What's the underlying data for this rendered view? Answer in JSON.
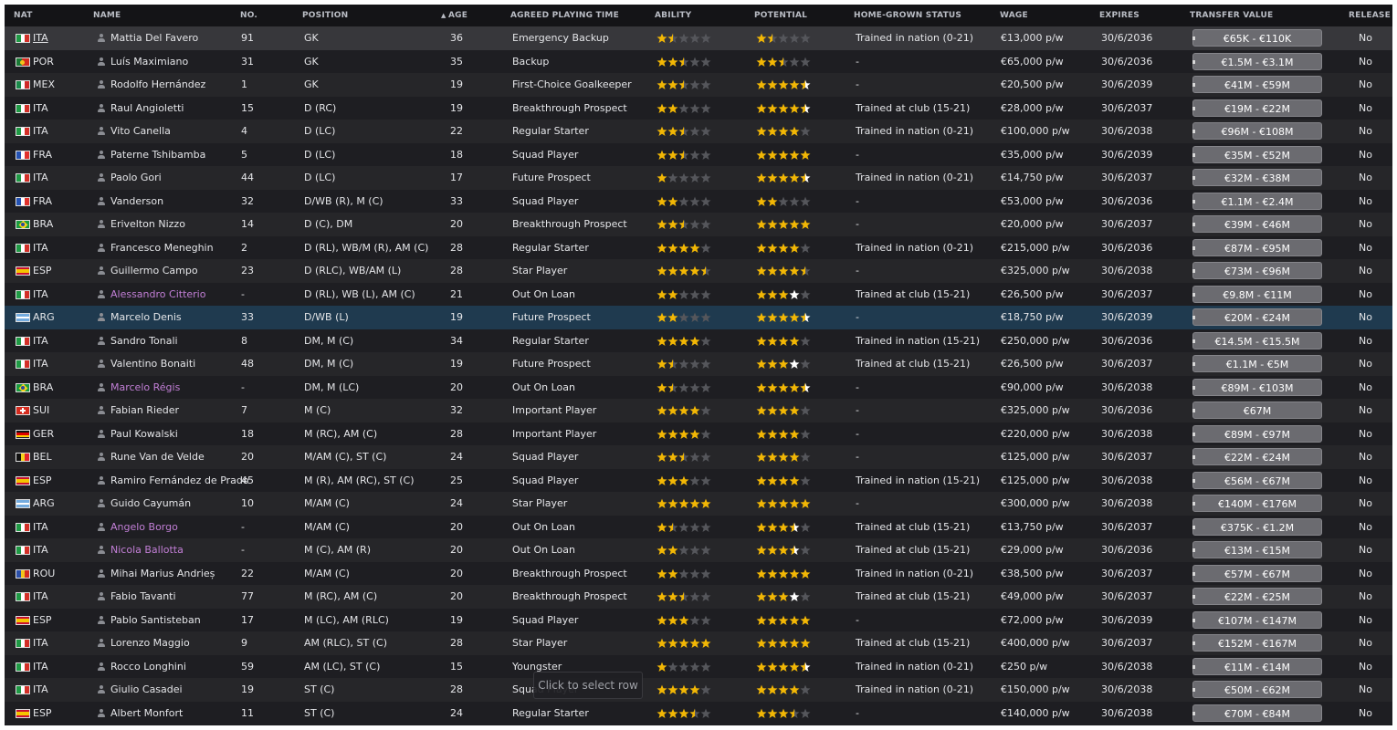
{
  "headers": {
    "nat": "NAT",
    "name": "NAME",
    "no": "NO.",
    "position": "POSITION",
    "age": "AGE",
    "playing_time": "AGREED PLAYING TIME",
    "ability": "ABILITY",
    "potential": "POTENTIAL",
    "home_grown": "HOME-GROWN STATUS",
    "wage": "WAGE",
    "expires": "EXPIRES",
    "transfer_value": "TRANSFER VALUE",
    "release": "RELEASE",
    "sort_indicator": "▲"
  },
  "tooltip": "Click to select row",
  "colors": {
    "star_gold": "#f2b705",
    "star_white": "#ffffff",
    "star_empty": "#55565b",
    "loan_name": "#c27fd6",
    "selected_row": "#1f3a4f"
  },
  "flags": {
    "ITA": [
      "#1f9a45",
      "#ffffff",
      "#d22f27"
    ],
    "FRA": [
      "#2452b3",
      "#ffffff",
      "#e0322d"
    ],
    "MEX": [
      "#1a8a4a",
      "#ffffff",
      "#cf2a27"
    ],
    "ROU": [
      "#2b4fa8",
      "#f3c51a",
      "#d52b1e"
    ],
    "BEL": [
      "#111111",
      "#f5d21c",
      "#e3232c"
    ]
  },
  "players": [
    {
      "nat": "ITA",
      "name": "Mattia Del Favero",
      "no": "91",
      "pos": "GK",
      "age": "36",
      "apt": "Emergency Backup",
      "ab": 1.5,
      "po": 1.5,
      "pw": false,
      "hg": "Trained in nation (0-21)",
      "wage": "€13,000 p/w",
      "exp": "30/6/2036",
      "tv": "€65K - €110K",
      "rel": "No"
    },
    {
      "nat": "POR",
      "name": "Luís Maximiano",
      "no": "31",
      "pos": "GK",
      "age": "35",
      "apt": "Backup",
      "ab": 2.5,
      "po": 2.5,
      "pw": false,
      "hg": "-",
      "wage": "€65,000 p/w",
      "exp": "30/6/2036",
      "tv": "€1.5M - €3.1M",
      "rel": "No"
    },
    {
      "nat": "MEX",
      "name": "Rodolfo Hernández",
      "no": "1",
      "pos": "GK",
      "age": "19",
      "apt": "First-Choice Goalkeeper",
      "ab": 2.5,
      "po": 4.5,
      "pw": true,
      "hg": "-",
      "wage": "€20,500 p/w",
      "exp": "30/6/2039",
      "tv": "€41M - €59M",
      "rel": "No"
    },
    {
      "nat": "ITA",
      "name": "Raul Angioletti",
      "no": "15",
      "pos": "D (RC)",
      "age": "19",
      "apt": "Breakthrough Prospect",
      "ab": 2,
      "po": 4.5,
      "pw": true,
      "hg": "Trained at club (15-21)",
      "wage": "€28,000 p/w",
      "exp": "30/6/2037",
      "tv": "€19M - €22M",
      "rel": "No"
    },
    {
      "nat": "ITA",
      "name": "Vito Canella",
      "no": "4",
      "pos": "D (LC)",
      "age": "22",
      "apt": "Regular Starter",
      "ab": 2.5,
      "po": 4,
      "pw": false,
      "hg": "Trained in nation (0-21)",
      "wage": "€100,000 p/w",
      "exp": "30/6/2038",
      "tv": "€96M - €108M",
      "rel": "No"
    },
    {
      "nat": "FRA",
      "name": "Paterne Tshibamba",
      "no": "5",
      "pos": "D (LC)",
      "age": "18",
      "apt": "Squad Player",
      "ab": 2.5,
      "po": 5,
      "pw": true,
      "hg": "-",
      "wage": "€35,000 p/w",
      "exp": "30/6/2039",
      "tv": "€35M - €52M",
      "rel": "No"
    },
    {
      "nat": "ITA",
      "name": "Paolo Gori",
      "no": "44",
      "pos": "D (LC)",
      "age": "17",
      "apt": "Future Prospect",
      "ab": 1,
      "po": 4.5,
      "pw": true,
      "hg": "Trained in nation (0-21)",
      "wage": "€14,750 p/w",
      "exp": "30/6/2037",
      "tv": "€32M - €38M",
      "rel": "No"
    },
    {
      "nat": "FRA",
      "name": "Vanderson",
      "no": "32",
      "pos": "D/WB (R), M (C)",
      "age": "33",
      "apt": "Squad Player",
      "ab": 2,
      "po": 2,
      "pw": false,
      "hg": "-",
      "wage": "€53,000 p/w",
      "exp": "30/6/2036",
      "tv": "€1.1M - €2.4M",
      "rel": "No"
    },
    {
      "nat": "BRA",
      "name": "Erivelton Nizzo",
      "no": "14",
      "pos": "D (C), DM",
      "age": "20",
      "apt": "Breakthrough Prospect",
      "ab": 2.5,
      "po": 5,
      "pw": true,
      "hg": "-",
      "wage": "€20,000 p/w",
      "exp": "30/6/2037",
      "tv": "€39M - €46M",
      "rel": "No"
    },
    {
      "nat": "ITA",
      "name": "Francesco Meneghin",
      "no": "2",
      "pos": "D (RL), WB/M (R), AM (C)",
      "age": "28",
      "apt": "Regular Starter",
      "ab": 4,
      "po": 4,
      "pw": false,
      "hg": "Trained in nation (0-21)",
      "wage": "€215,000 p/w",
      "exp": "30/6/2036",
      "tv": "€87M - €95M",
      "rel": "No"
    },
    {
      "nat": "ESP",
      "name": "Guillermo Campo",
      "no": "23",
      "pos": "D (RLC), WB/AM (L)",
      "age": "28",
      "apt": "Star Player",
      "ab": 4.5,
      "po": 4.5,
      "pw": false,
      "hg": "-",
      "wage": "€325,000 p/w",
      "exp": "30/6/2038",
      "tv": "€73M - €96M",
      "rel": "No"
    },
    {
      "nat": "ITA",
      "name": "Alessandro Citterio",
      "loan": true,
      "no": "-",
      "pos": "D (RL), WB (L), AM (C)",
      "age": "21",
      "apt": "Out On Loan",
      "ab": 2,
      "po": 4,
      "pw": true,
      "hg": "Trained at club (15-21)",
      "wage": "€26,500 p/w",
      "exp": "30/6/2037",
      "tv": "€9.8M - €11M",
      "rel": "No"
    },
    {
      "nat": "ARG",
      "name": "Marcelo Denis",
      "no": "33",
      "pos": "D/WB (L)",
      "age": "19",
      "apt": "Future Prospect",
      "ab": 2,
      "po": 4.5,
      "pw": true,
      "hg": "-",
      "wage": "€18,750 p/w",
      "exp": "30/6/2039",
      "tv": "€20M - €24M",
      "rel": "No"
    },
    {
      "nat": "ITA",
      "name": "Sandro Tonali",
      "no": "8",
      "pos": "DM, M (C)",
      "age": "34",
      "apt": "Regular Starter",
      "ab": 4,
      "po": 4,
      "pw": false,
      "hg": "Trained in nation (15-21)",
      "wage": "€250,000 p/w",
      "exp": "30/6/2036",
      "tv": "€14.5M - €15.5M",
      "rel": "No"
    },
    {
      "nat": "ITA",
      "name": "Valentino Bonaiti",
      "no": "48",
      "pos": "DM, M (C)",
      "age": "19",
      "apt": "Future Prospect",
      "ab": 1.5,
      "po": 4,
      "pw": true,
      "hg": "Trained at club (15-21)",
      "wage": "€26,500 p/w",
      "exp": "30/6/2037",
      "tv": "€1.1M - €5M",
      "rel": "No"
    },
    {
      "nat": "BRA",
      "name": "Marcelo Régis",
      "loan": true,
      "no": "-",
      "pos": "DM, M (LC)",
      "age": "20",
      "apt": "Out On Loan",
      "ab": 1.5,
      "po": 4.5,
      "pw": true,
      "hg": "-",
      "wage": "€90,000 p/w",
      "exp": "30/6/2038",
      "tv": "€89M - €103M",
      "rel": "No"
    },
    {
      "nat": "SUI",
      "name": "Fabian Rieder",
      "no": "7",
      "pos": "M (C)",
      "age": "32",
      "apt": "Important Player",
      "ab": 4,
      "po": 4,
      "pw": false,
      "hg": "-",
      "wage": "€325,000 p/w",
      "exp": "30/6/2036",
      "tv": "€67M",
      "rel": "No"
    },
    {
      "nat": "GER",
      "name": "Paul Kowalski",
      "no": "18",
      "pos": "M (RC), AM (C)",
      "age": "28",
      "apt": "Important Player",
      "ab": 4,
      "po": 4,
      "pw": false,
      "hg": "-",
      "wage": "€220,000 p/w",
      "exp": "30/6/2038",
      "tv": "€89M - €97M",
      "rel": "No"
    },
    {
      "nat": "BEL",
      "name": "Rune Van de Velde",
      "no": "20",
      "pos": "M/AM (C), ST (C)",
      "age": "24",
      "apt": "Squad Player",
      "ab": 2.5,
      "po": 4,
      "pw": false,
      "hg": "-",
      "wage": "€125,000 p/w",
      "exp": "30/6/2037",
      "tv": "€22M - €24M",
      "rel": "No"
    },
    {
      "nat": "ESP",
      "name": "Ramiro Fernández de Prado",
      "no": "45",
      "pos": "M (R), AM (RC), ST (C)",
      "age": "25",
      "apt": "Squad Player",
      "ab": 3,
      "po": 4,
      "pw": false,
      "hg": "Trained in nation (15-21)",
      "wage": "€125,000 p/w",
      "exp": "30/6/2038",
      "tv": "€56M - €67M",
      "rel": "No"
    },
    {
      "nat": "ARG",
      "name": "Guido Cayumán",
      "no": "10",
      "pos": "M/AM (C)",
      "age": "24",
      "apt": "Star Player",
      "ab": 5,
      "po": 5,
      "pw": false,
      "hg": "-",
      "wage": "€300,000 p/w",
      "exp": "30/6/2038",
      "tv": "€140M - €176M",
      "rel": "No"
    },
    {
      "nat": "ITA",
      "name": "Angelo Borgo",
      "loan": true,
      "no": "-",
      "pos": "M/AM (C)",
      "age": "20",
      "apt": "Out On Loan",
      "ab": 1.5,
      "po": 3.5,
      "pw": true,
      "hg": "Trained at club (15-21)",
      "wage": "€13,750 p/w",
      "exp": "30/6/2037",
      "tv": "€375K - €1.2M",
      "rel": "No"
    },
    {
      "nat": "ITA",
      "name": "Nicola Ballotta",
      "loan": true,
      "no": "-",
      "pos": "M (C), AM (R)",
      "age": "20",
      "apt": "Out On Loan",
      "ab": 2,
      "po": 3.5,
      "pw": true,
      "hg": "Trained at club (15-21)",
      "wage": "€29,000 p/w",
      "exp": "30/6/2036",
      "tv": "€13M - €15M",
      "rel": "No"
    },
    {
      "nat": "ROU",
      "name": "Mihai Marius Andrieș",
      "no": "22",
      "pos": "M/AM (C)",
      "age": "20",
      "apt": "Breakthrough Prospect",
      "ab": 2,
      "po": 5,
      "pw": true,
      "hg": "Trained in nation (0-21)",
      "wage": "€38,500 p/w",
      "exp": "30/6/2037",
      "tv": "€57M - €67M",
      "rel": "No"
    },
    {
      "nat": "ITA",
      "name": "Fabio Tavanti",
      "no": "77",
      "pos": "M (RC), AM (C)",
      "age": "20",
      "apt": "Breakthrough Prospect",
      "ab": 2.5,
      "po": 4,
      "pw": true,
      "hg": "Trained at club (15-21)",
      "wage": "€49,000 p/w",
      "exp": "30/6/2037",
      "tv": "€22M - €25M",
      "rel": "No"
    },
    {
      "nat": "ESP",
      "name": "Pablo Santisteban",
      "no": "17",
      "pos": "M (LC), AM (RLC)",
      "age": "19",
      "apt": "Squad Player",
      "ab": 3,
      "po": 5,
      "pw": true,
      "hg": "-",
      "wage": "€72,000 p/w",
      "exp": "30/6/2039",
      "tv": "€107M - €147M",
      "rel": "No"
    },
    {
      "nat": "ITA",
      "name": "Lorenzo Maggio",
      "no": "9",
      "pos": "AM (RLC), ST (C)",
      "age": "28",
      "apt": "Star Player",
      "ab": 5,
      "po": 5,
      "pw": false,
      "hg": "Trained at club (15-21)",
      "wage": "€400,000 p/w",
      "exp": "30/6/2037",
      "tv": "€152M - €167M",
      "rel": "No"
    },
    {
      "nat": "ITA",
      "name": "Rocco Longhini",
      "no": "59",
      "pos": "AM (LC), ST (C)",
      "age": "15",
      "apt": "Youngster",
      "ab": 1,
      "po": 4.5,
      "pw": true,
      "hg": "Trained in nation (0-21)",
      "wage": "€250 p/w",
      "exp": "30/6/2038",
      "tv": "€11M - €14M",
      "rel": "No"
    },
    {
      "nat": "ITA",
      "name": "Giulio Casadei",
      "no": "19",
      "pos": "ST (C)",
      "age": "28",
      "apt": "Squad Player",
      "ab": 4,
      "po": 4,
      "pw": false,
      "hg": "Trained in nation (0-21)",
      "wage": "€150,000 p/w",
      "exp": "30/6/2038",
      "tv": "€50M - €62M",
      "rel": "No"
    },
    {
      "nat": "ESP",
      "name": "Albert Monfort",
      "no": "11",
      "pos": "ST (C)",
      "age": "24",
      "apt": "Regular Starter",
      "ab": 3.5,
      "po": 3.5,
      "pw": false,
      "hg": "-",
      "wage": "€140,000 p/w",
      "exp": "30/6/2038",
      "tv": "€70M - €84M",
      "rel": "No"
    }
  ]
}
